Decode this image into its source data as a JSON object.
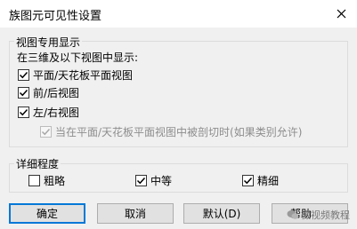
{
  "window": {
    "title": "族图元可见性设置"
  },
  "view_group": {
    "label": "视图专用显示",
    "subheading": "在三维及以下视图中显示:",
    "options": [
      {
        "label": "平面/天花板平面视图",
        "checked": true
      },
      {
        "label": "前/后视图",
        "checked": true
      },
      {
        "label": "左/右视图",
        "checked": true
      },
      {
        "label": "当在平面/天花板平面视图中被剖切时(如果类别允许)",
        "checked": true,
        "disabled": true
      }
    ]
  },
  "detail_group": {
    "label": "详细程度",
    "options": [
      {
        "label": "粗略",
        "checked": false
      },
      {
        "label": "中等",
        "checked": true
      },
      {
        "label": "精细",
        "checked": true
      }
    ]
  },
  "buttons": {
    "ok": "确定",
    "cancel": "取消",
    "default": "默认(D)",
    "help": "帮助"
  },
  "watermark": "微视频教程"
}
